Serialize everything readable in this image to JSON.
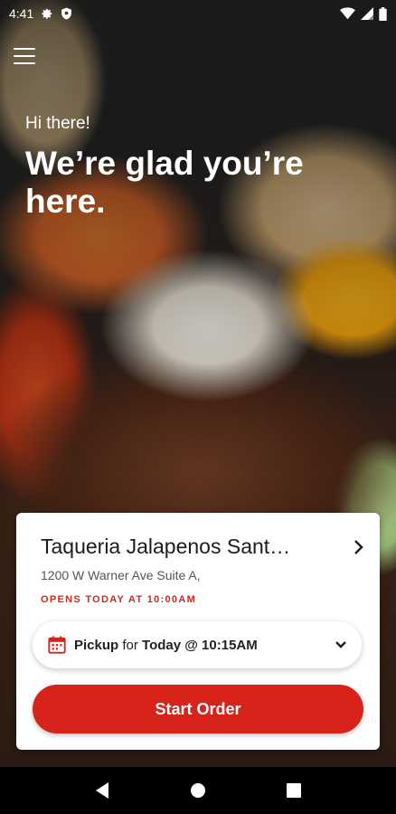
{
  "status_bar": {
    "time": "4:41",
    "icons": [
      "settings-icon",
      "shield-icon",
      "wifi-icon",
      "signal-icon",
      "battery-icon"
    ]
  },
  "header": {
    "menu_icon": "hamburger-menu-icon"
  },
  "greeting": {
    "subtitle": "Hi there!",
    "title": "We’re glad you’re here."
  },
  "store_card": {
    "name": "Taqueria Jalapenos Sant…",
    "address": "1200 W Warner Ave Suite A,",
    "open_status": "OPENS TODAY AT 10:00AM",
    "pickup": {
      "mode": "Pickup",
      "connector": " for ",
      "time": "Today @ 10:15AM"
    },
    "start_button": "Start Order"
  },
  "colors": {
    "accent": "#d8231a",
    "status_red": "#d8251c"
  },
  "nav_bar": {
    "icons": [
      "back-icon",
      "home-icon",
      "recents-icon"
    ]
  }
}
